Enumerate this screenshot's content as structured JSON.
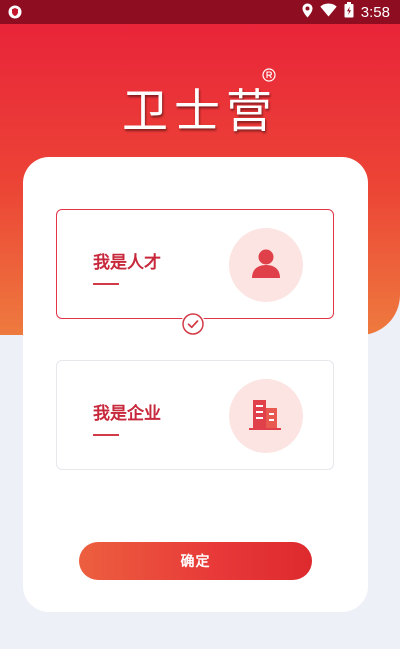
{
  "status_bar": {
    "time": "3:58",
    "icons": [
      "app-shield-icon",
      "location-icon",
      "wifi-icon",
      "battery-icon"
    ]
  },
  "app": {
    "title": "卫士营",
    "title_mark": "registered-mark-icon"
  },
  "options": [
    {
      "label": "我是人才",
      "icon": "person-icon",
      "selected": true
    },
    {
      "label": "我是企业",
      "icon": "building-icon",
      "selected": false
    }
  ],
  "confirm_button": {
    "label": "确定"
  },
  "colors": {
    "status_bar": "#8e0d20",
    "hero_top": "#e8203a",
    "hero_bottom": "#ee7a3e",
    "accent": "#e43448",
    "page_background": "#eef0f8"
  }
}
